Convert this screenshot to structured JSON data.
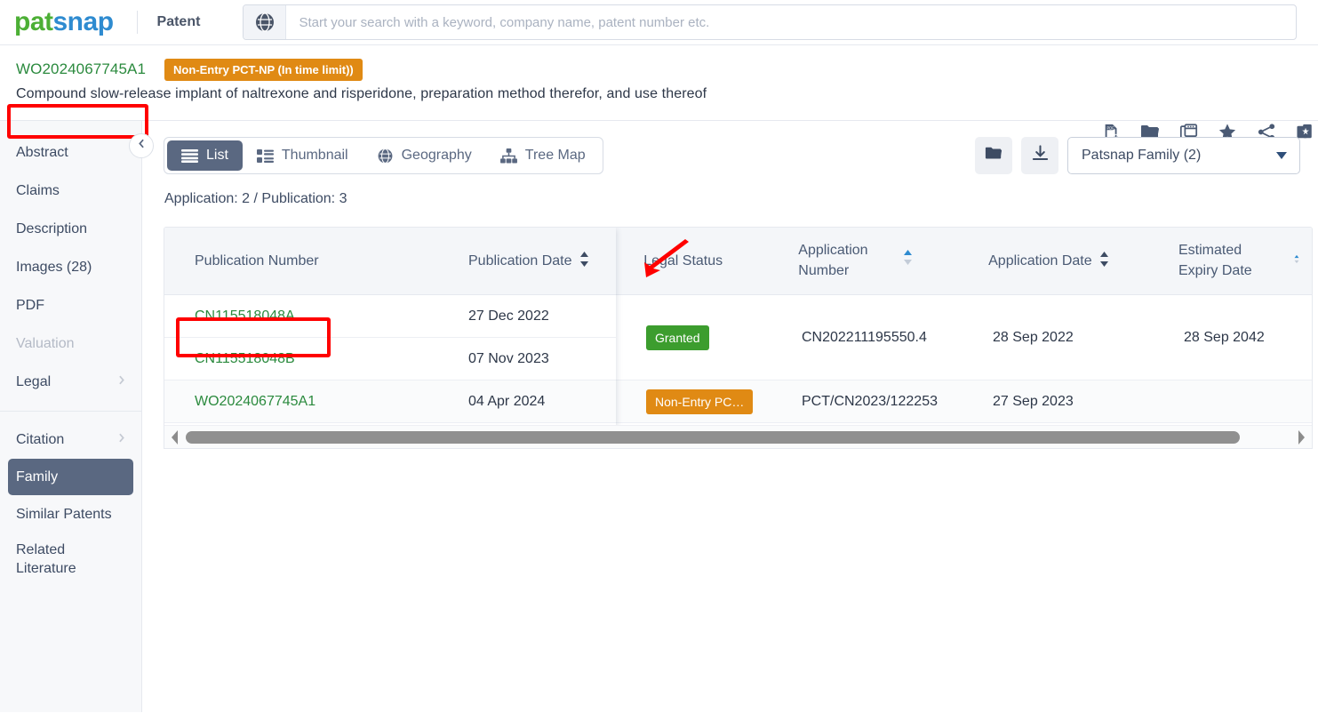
{
  "topbar": {
    "logo_pat": "pat",
    "logo_snap": "snap",
    "section": "Patent",
    "globe_icon": "globe-icon",
    "search_placeholder": "Start your search with a keyword, company name, patent number etc.",
    "search_value": ""
  },
  "patent_header": {
    "publication_number": "WO2024067745A1",
    "status_chip": "Non-Entry PCT-NP (In time limit))",
    "title": "Compound slow-release implant of naltrexone and risperidone, preparation method therefor, and use thereof",
    "icons": [
      {
        "name": "pdf-download-icon"
      },
      {
        "name": "folder-icon"
      },
      {
        "name": "window-copy-icon"
      },
      {
        "name": "star-icon"
      },
      {
        "name": "share-icon"
      },
      {
        "name": "cards-icon"
      }
    ]
  },
  "sidebar": {
    "collapse_icon": "chevron-left-icon",
    "items": [
      {
        "label": "Abstract",
        "state": "normal",
        "chevron": false
      },
      {
        "label": "Claims",
        "state": "normal",
        "chevron": false
      },
      {
        "label": "Description",
        "state": "normal",
        "chevron": false
      },
      {
        "label": "Images (28)",
        "state": "normal",
        "chevron": false
      },
      {
        "label": "PDF",
        "state": "normal",
        "chevron": false
      },
      {
        "label": "Valuation",
        "state": "disabled",
        "chevron": false
      },
      {
        "label": "Legal",
        "state": "normal",
        "chevron": true
      }
    ],
    "items2": [
      {
        "label": "Citation",
        "state": "normal",
        "chevron": true
      },
      {
        "label": "Family",
        "state": "active",
        "chevron": false
      },
      {
        "label": "Similar Patents",
        "state": "normal",
        "chevron": false
      }
    ],
    "related_line1": "Related",
    "related_line2": "Literature"
  },
  "main": {
    "tabs": [
      {
        "label": "List",
        "icon": "list-icon",
        "active": true
      },
      {
        "label": "Thumbnail",
        "icon": "thumbnail-icon",
        "active": false
      },
      {
        "label": "Geography",
        "icon": "globe-icon",
        "active": false
      },
      {
        "label": "Tree Map",
        "icon": "tree-map-icon",
        "active": false
      }
    ],
    "folder_button_icon": "folder-icon",
    "download_button_icon": "download-icon",
    "family_select_value": "Patsnap Family (2)",
    "count_line": "Application: 2 / Publication: 3"
  },
  "table": {
    "columns": [
      {
        "label": "Publication Number",
        "sortable": false,
        "sort_state": "none"
      },
      {
        "label": "Publication Date",
        "sortable": true,
        "sort_state": "none"
      },
      {
        "label": "Legal Status",
        "sortable": false,
        "sort_state": "none"
      },
      {
        "label": "Application Number",
        "sortable": true,
        "sort_state": "asc"
      },
      {
        "label": "Application Date",
        "sortable": true,
        "sort_state": "none"
      },
      {
        "label": "Estimated Expiry Date",
        "sortable": false,
        "sort_state": "none"
      }
    ],
    "publications": [
      {
        "number": "CN115518048A",
        "date": "27 Dec 2022"
      },
      {
        "number": "CN115518048B",
        "date": "07 Nov 2023"
      },
      {
        "number": "WO2024067745A1",
        "date": "04 Apr 2024"
      }
    ],
    "applications": [
      {
        "legal_status": "Granted",
        "legal_status_color": "#3c9d2e",
        "application_number": "CN202211195550.4",
        "application_date": "28 Sep 2022",
        "estimated_expiry_date": "28 Sep 2042",
        "rowspan": 2
      },
      {
        "legal_status": "Non-Entry PC…",
        "legal_status_color": "#e08a14",
        "application_number": "PCT/CN2023/122253",
        "application_date": "27 Sep 2023",
        "estimated_expiry_date": "",
        "rowspan": 1
      }
    ],
    "scrollbar": {
      "left_arrow_icon": "scroll-left-arrow-icon",
      "right_arrow_icon": "scroll-right-arrow-icon"
    }
  },
  "annotations": {
    "highlight_publication_number": "WO2024067745A1",
    "highlight_row_publication": "CN115518048B",
    "arrow_target": "Granted",
    "color": "#ff0000"
  }
}
